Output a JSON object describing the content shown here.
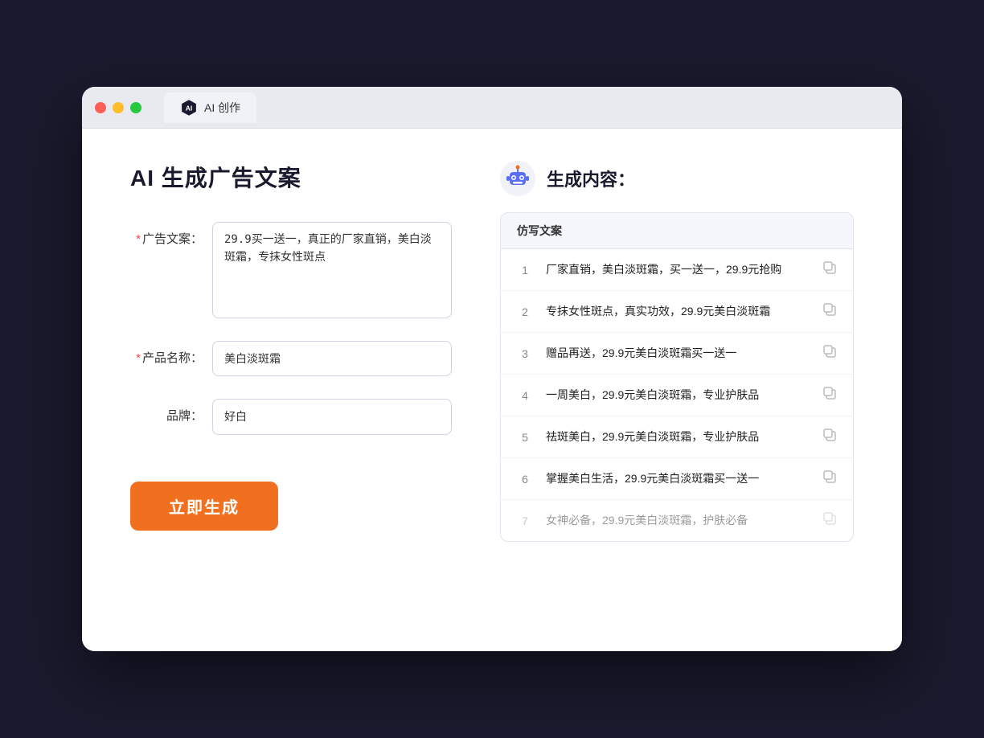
{
  "browser": {
    "tab_title": "AI 创作"
  },
  "left": {
    "main_title": "AI 生成广告文案",
    "ad_label": "广告文案：",
    "ad_required": "*",
    "ad_value": "29.9买一送一，真正的厂家直销，美白淡斑霜，专抹女性斑点",
    "product_label": "产品名称：",
    "product_required": "*",
    "product_value": "美白淡斑霜",
    "brand_label": "品牌：",
    "brand_value": "好白",
    "generate_btn": "立即生成"
  },
  "right": {
    "title": "生成内容：",
    "column_header": "仿写文案",
    "results": [
      {
        "num": "1",
        "text": "厂家直销，美白淡斑霜，买一送一，29.9元抢购",
        "dimmed": false
      },
      {
        "num": "2",
        "text": "专抹女性斑点，真实功效，29.9元美白淡斑霜",
        "dimmed": false
      },
      {
        "num": "3",
        "text": "赠品再送，29.9元美白淡斑霜买一送一",
        "dimmed": false
      },
      {
        "num": "4",
        "text": "一周美白，29.9元美白淡斑霜，专业护肤品",
        "dimmed": false
      },
      {
        "num": "5",
        "text": "祛斑美白，29.9元美白淡斑霜，专业护肤品",
        "dimmed": false
      },
      {
        "num": "6",
        "text": "掌握美白生活，29.9元美白淡斑霜买一送一",
        "dimmed": false
      },
      {
        "num": "7",
        "text": "女神必备，29.9元美白淡斑霜，护肤必备",
        "dimmed": true
      }
    ]
  }
}
